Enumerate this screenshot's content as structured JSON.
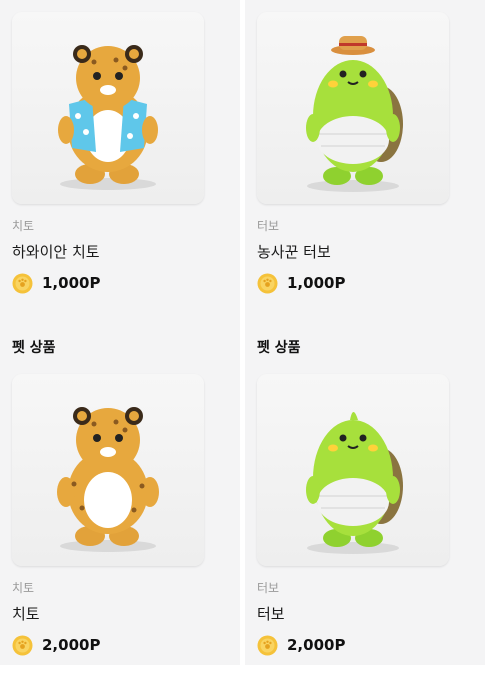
{
  "columns": [
    {
      "items": [
        {
          "brand": "치토",
          "name": "하와이안 치토",
          "price": "1,000P",
          "image_icon": "cheetah-hawaiian-figure-icon"
        },
        {
          "brand": "치토",
          "name": "치토",
          "price": "2,000P",
          "image_icon": "cheetah-figure-icon"
        }
      ],
      "section_title": "펫 상품"
    },
    {
      "items": [
        {
          "brand": "터보",
          "name": "농사꾼 터보",
          "price": "1,000P",
          "image_icon": "turtle-farmer-figure-icon"
        },
        {
          "brand": "터보",
          "name": "터보",
          "price": "2,000P",
          "image_icon": "turtle-figure-icon"
        }
      ],
      "section_title": "펫 상품"
    }
  ],
  "colors": {
    "coin": "#f5c23a",
    "cheetah": "#e4a43b",
    "turtle": "#a7e03c",
    "shirt": "#5fc7ea",
    "hat": "#d98f3e"
  }
}
